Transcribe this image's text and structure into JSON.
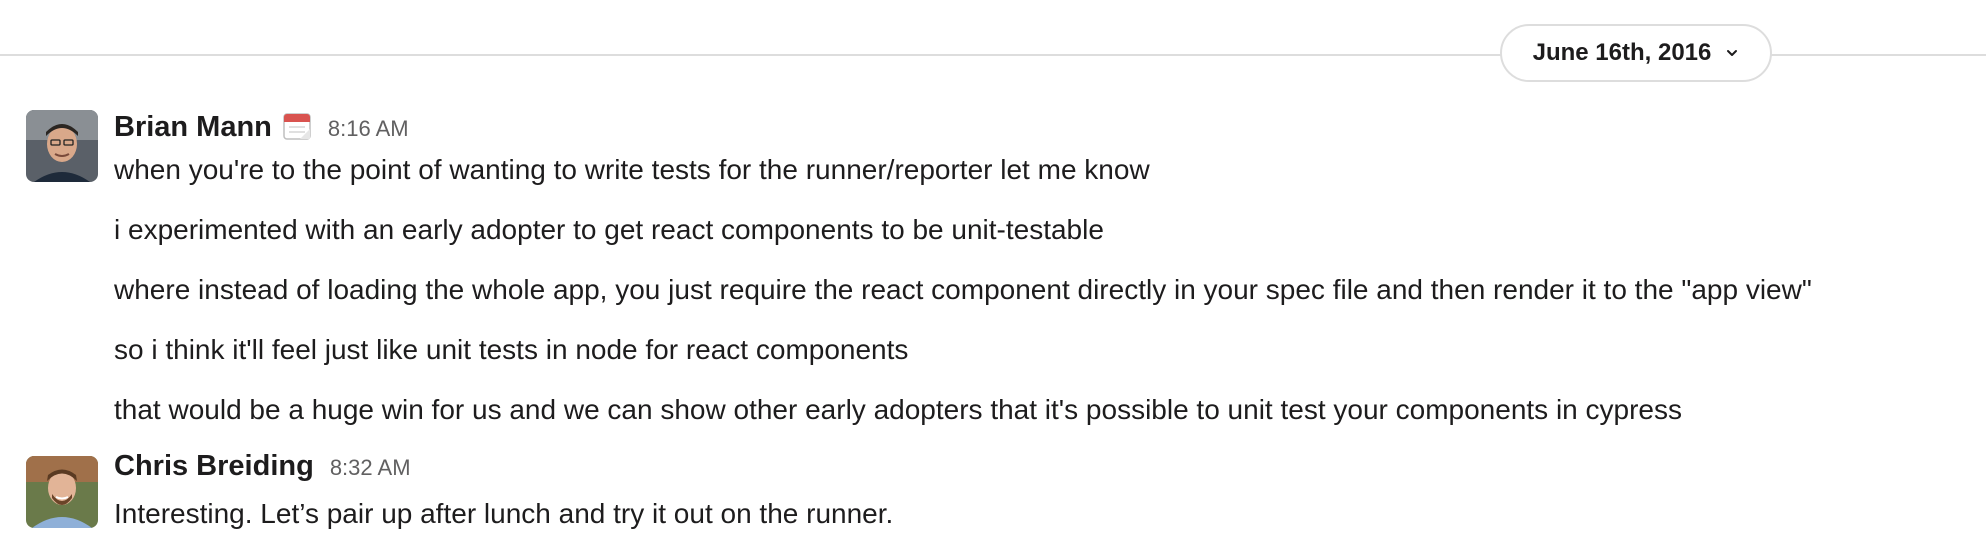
{
  "date_divider": {
    "label": "June 16th, 2016",
    "icon": "chevron-down-icon"
  },
  "messages": [
    {
      "sender": "Brian Mann",
      "status_icon": "calendar-icon",
      "time": "8:16 AM",
      "lines": [
        "when you're to the point of wanting to write tests for the runner/reporter let me know",
        "i experimented with an early adopter to get react components to be unit-testable",
        "where instead of loading the whole app, you just require the react component directly in your spec file and then render it to the \"app view\"",
        "so i think it'll feel just like unit tests in node for react components",
        "that would be a huge win for us and we can show other early adopters that it's possible to unit test your components in cypress"
      ]
    },
    {
      "sender": "Chris Breiding",
      "time": "8:32 AM",
      "lines": [
        "Interesting. Let’s pair up after lunch and try it out on the runner."
      ]
    }
  ],
  "colors": {
    "text": "#1d1c1d",
    "muted": "#616061",
    "divider": "#dddddd"
  }
}
